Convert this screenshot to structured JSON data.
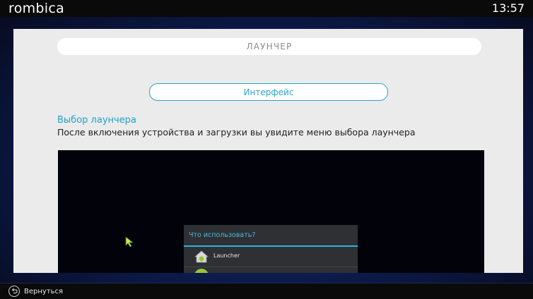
{
  "status_bar": {
    "brand": "rombica",
    "clock": "13:57"
  },
  "page": {
    "title": "ЛАУНЧЕР",
    "pill": "Интерфейс",
    "section_heading": "Выбор лаунчера",
    "section_text": "После включения устройства и загрузки вы увидите меню выбора лаунчера"
  },
  "screenshot": {
    "dialog_title": "Что использовать?",
    "items": [
      {
        "label": "Launcher",
        "icon": "android-home-icon"
      },
      {
        "label": "",
        "icon": "android-app-icon"
      }
    ]
  },
  "bottom_bar": {
    "back_label": "Вернуться",
    "back_icon": "back-arrow-icon"
  },
  "colors": {
    "accent": "#2aa5c8",
    "panel_bg": "#ebebeb",
    "bar_bg": "#0a0a0a"
  }
}
